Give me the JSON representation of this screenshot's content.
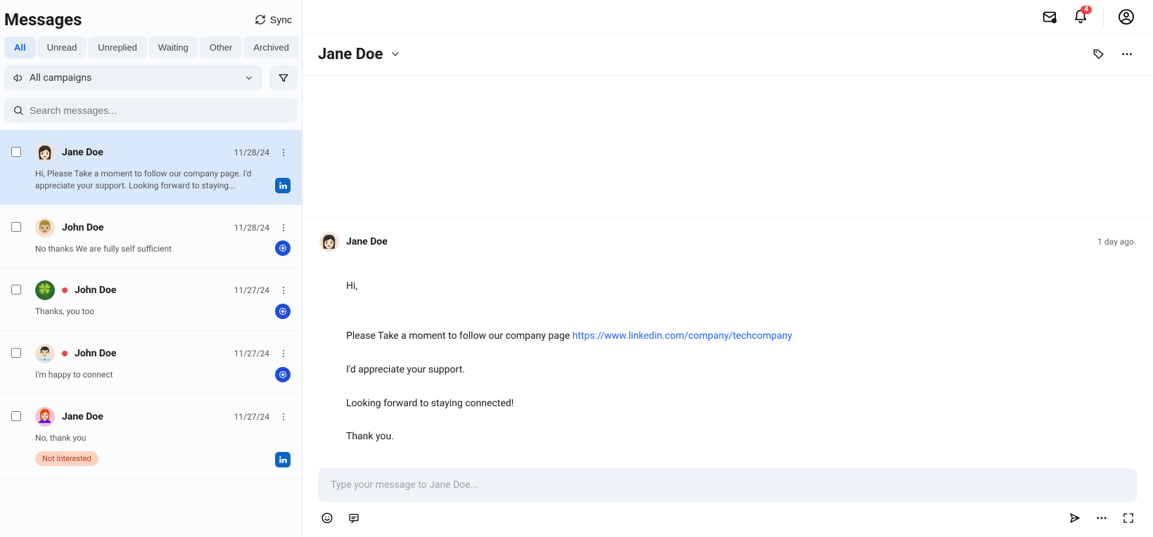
{
  "sidebar": {
    "title": "Messages",
    "sync_label": "Sync",
    "tabs": [
      {
        "label": "All",
        "active": true
      },
      {
        "label": "Unread"
      },
      {
        "label": "Unreplied"
      },
      {
        "label": "Waiting"
      },
      {
        "label": "Other"
      },
      {
        "label": "Archived"
      }
    ],
    "campaigns_label": "All campaigns",
    "search_placeholder": "Search messages..."
  },
  "messages": [
    {
      "name": "Jane Doe",
      "date": "11/28/24",
      "preview": "Hi, Please Take a moment to follow our company page. I'd appreciate your support. Looking forward to staying...",
      "avatar_emoji": "👩🏻",
      "source": "linkedin",
      "selected": true,
      "unread": false
    },
    {
      "name": "John Doe",
      "date": "11/28/24",
      "preview": "No thanks We are fully self sufficient",
      "avatar_emoji": "👨🏼",
      "source": "nav",
      "unread": false
    },
    {
      "name": "John Doe",
      "date": "11/27/24",
      "preview": "Thanks, you too",
      "avatar_emoji": "🍀",
      "avatar_bg": "#2f6b2f",
      "source": "nav",
      "unread": true
    },
    {
      "name": "John Doe",
      "date": "11/27/24",
      "preview": "I'm happy to connect",
      "avatar_emoji": "👨🏻‍💼",
      "source": "nav",
      "unread": true
    },
    {
      "name": "Jane Doe",
      "date": "11/27/24",
      "preview": "No, thank you",
      "avatar_emoji": "👩🏻‍🦰",
      "avatar_bg": "#f2c3dd",
      "source": "linkedin",
      "unread": false,
      "tag": "Not Interested"
    }
  ],
  "topbar": {
    "notification_count": "4"
  },
  "conversation": {
    "title": "Jane Doe",
    "sender_name": "Jane Doe",
    "sender_avatar_emoji": "👩🏻",
    "timestamp": "1 day ago.",
    "body_intro": "Hi,",
    "body_line1_pre": "Please Take a moment to follow our company page ",
    "body_link": "https://www.linkedin.com/company/techcompany",
    "body_line2": "I'd appreciate your support.",
    "body_line3": "Looking forward to staying connected!",
    "body_line4": "Thank you.",
    "compose_placeholder": "Type your message to Jane Doe..."
  }
}
